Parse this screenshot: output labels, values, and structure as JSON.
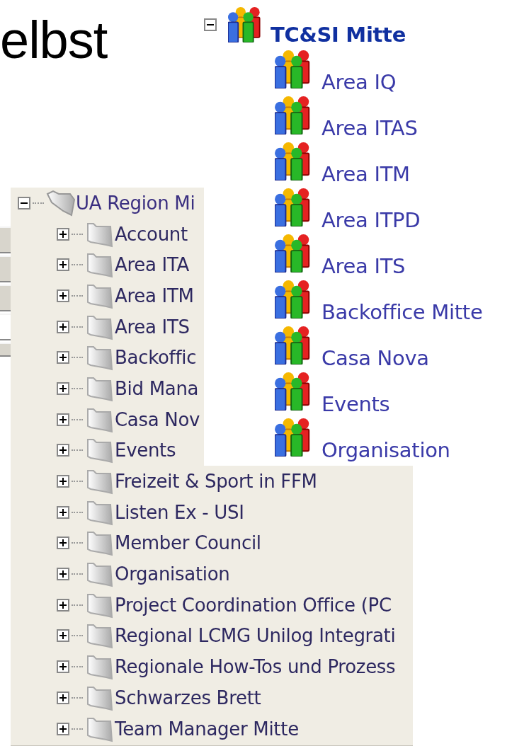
{
  "heading": "elbst",
  "folder_tree": {
    "label": "UA Region Mi",
    "expanded": true,
    "children": [
      {
        "label": "Account",
        "expanded": false
      },
      {
        "label": "Area ITA",
        "expanded": false
      },
      {
        "label": "Area ITM",
        "expanded": false
      },
      {
        "label": "Area ITS",
        "expanded": false
      },
      {
        "label": "Backoffic",
        "expanded": false
      },
      {
        "label": "Bid Mana",
        "expanded": false
      },
      {
        "label": "Casa Nov",
        "expanded": false
      },
      {
        "label": "Events",
        "expanded": false
      },
      {
        "label": "Freizeit & Sport in FFM",
        "expanded": false
      },
      {
        "label": "Listen Ex - USI",
        "expanded": false
      },
      {
        "label": "Member Council",
        "expanded": false
      },
      {
        "label": "Organisation",
        "expanded": false
      },
      {
        "label": "Project Coordination Office (PC",
        "expanded": false
      },
      {
        "label": "Regional LCMG Unilog Integrati",
        "expanded": false
      },
      {
        "label": "Regionale How-Tos und Prozess",
        "expanded": false
      },
      {
        "label": "Schwarzes Brett",
        "expanded": false
      },
      {
        "label": "Team Manager Mitte",
        "expanded": false
      }
    ]
  },
  "group_tree": {
    "label": "TC&SI Mitte",
    "expanded": true,
    "children": [
      {
        "label": "Area IQ"
      },
      {
        "label": "Area ITAS"
      },
      {
        "label": "Area ITM"
      },
      {
        "label": "Area ITPD"
      },
      {
        "label": "Area ITS"
      },
      {
        "label": "Backoffice Mitte"
      },
      {
        "label": "Casa Nova"
      },
      {
        "label": "Events"
      },
      {
        "label": "Organisation"
      }
    ]
  }
}
